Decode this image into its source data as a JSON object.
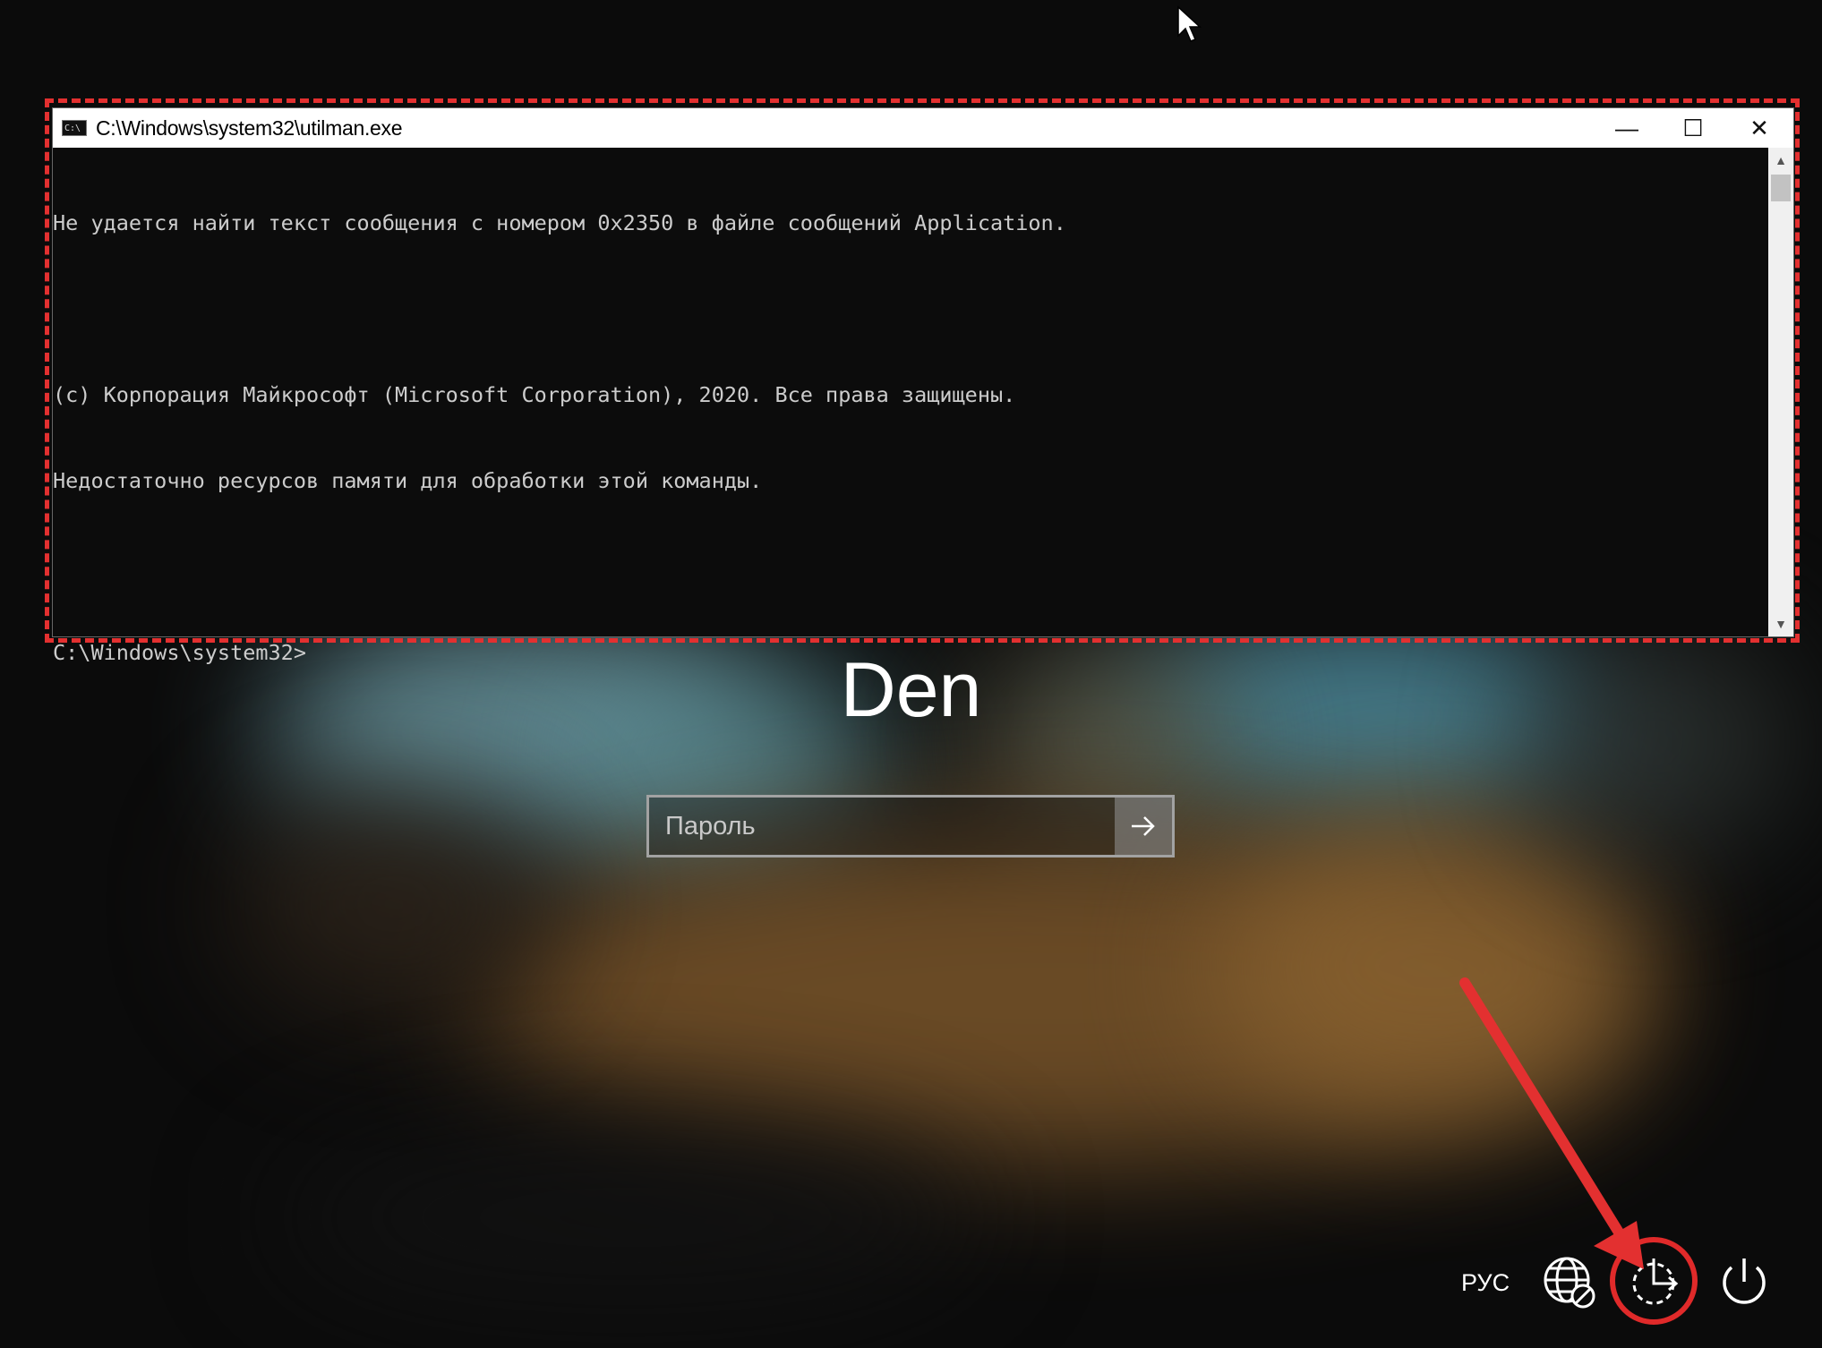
{
  "console_window": {
    "title": "C:\\Windows\\system32\\utilman.exe",
    "icon_label": "C:\\",
    "controls": {
      "minimize": "—",
      "maximize": "☐",
      "close": "✕"
    },
    "lines": [
      "Не удается найти текст сообщения с номером 0x2350 в файле сообщений Application.",
      "",
      "(с) Корпорация Майкрософт (Microsoft Corporation), 2020. Все права защищены.",
      "Недостаточно ресурсов памяти для обработки этой команды.",
      "",
      "C:\\Windows\\system32>"
    ]
  },
  "login": {
    "username": "Den",
    "password_placeholder": "Пароль",
    "submit_icon": "arrow-right-icon"
  },
  "tray": {
    "language": "РУС",
    "icons": [
      "network-icon",
      "ease-of-access-icon",
      "power-icon"
    ]
  },
  "annotations": {
    "highlight_color": "#e33030"
  }
}
